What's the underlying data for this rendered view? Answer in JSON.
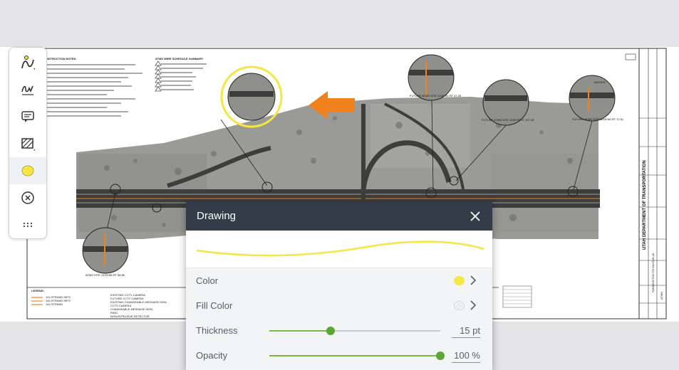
{
  "toolbar": {
    "tools": [
      {
        "name": "shape-tool",
        "icon": "pen-curve-icon"
      },
      {
        "name": "signature-tool",
        "icon": "signature-icon"
      },
      {
        "name": "comment-tool",
        "icon": "comment-icon"
      },
      {
        "name": "hatch-tool",
        "icon": "hatch-icon"
      },
      {
        "name": "color-tool",
        "icon": "yellow-circle-icon"
      },
      {
        "name": "cancel-tool",
        "icon": "close-circle-icon"
      },
      {
        "name": "more-tool",
        "icon": "more-dots-icon"
      }
    ]
  },
  "drawing_sheet": {
    "notes_heading": "INSTRUCTION NOTES:",
    "schedule_heading": "ATMS WIRE SCHEDULE SUMMARY",
    "legend_heading": "LEGEND:",
    "legend_left": [
      "144 STRAND INFO",
      "144 STRAND INFO",
      "144 STRAND"
    ],
    "legend_right": [
      "EXISTING CCTV CAMERA",
      "FUTURE CCTV CAMERA",
      "EXISTING CHANGEABLE MESSAGE SIGN",
      "CCTV CAMERA",
      "CHANGEABLE MESSAGE SIGN",
      "RING",
      "NON-INTRUSIVE DETECTOR"
    ],
    "callouts": [
      "FUTURE ATMS SITE 1235+60 RT 47.20",
      "FUTURE ATMS SITE 1240+55 LT 107.45",
      "FUTURE ATMS SITE 1245+80 RT 72.51",
      "ATMS SITE 1233+88 RT 58.80"
    ],
    "title_block": {
      "agency": "UTAH DEPARTMENT OF TRANSPORTATION",
      "project": "FARMINGTON TO KAYSVILLE",
      "sheet": "ATMS",
      "region_word": "WOODS"
    }
  },
  "drawing_panel": {
    "title": "Drawing",
    "preview_color": "#f5e642",
    "rows": {
      "color": {
        "label": "Color",
        "value_color": "#f5e642"
      },
      "fill": {
        "label": "Fill Color"
      },
      "thickness": {
        "label": "Thickness",
        "value": "15 pt",
        "level": 0.36
      },
      "opacity": {
        "label": "Opacity",
        "value": "100 %",
        "level": 1.0
      }
    }
  },
  "colors": {
    "accent_orange": "#f0821e",
    "highlight_yellow": "#f5e642",
    "slider_green": "#5ca633",
    "header_dark": "#343c49"
  }
}
